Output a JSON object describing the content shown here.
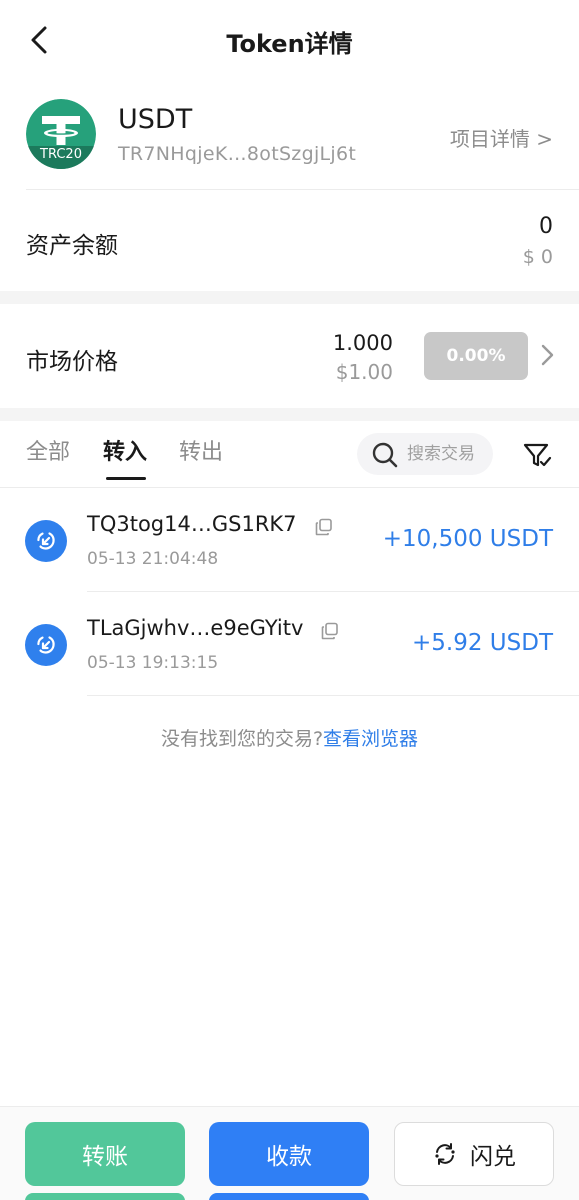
{
  "header": {
    "title": "Token详情"
  },
  "token": {
    "symbol": "USDT",
    "address": "TR7NHqjeK…8otSzgjLj6t",
    "project_detail": "项目详情 >",
    "logo_label": "TRC20",
    "logo_color": "#26a17b"
  },
  "balance": {
    "label": "资产余额",
    "amount": "0",
    "usd": "$ 0"
  },
  "market": {
    "label": "市场价格",
    "price": "1.000",
    "usd": "$1.00",
    "change": "0.00%"
  },
  "tabs": [
    {
      "label": "全部",
      "active": false
    },
    {
      "label": "转入",
      "active": true
    },
    {
      "label": "转出",
      "active": false
    }
  ],
  "search": {
    "placeholder": "搜索交易"
  },
  "transactions": [
    {
      "address": "TQ3tog14…GS1RK7",
      "time": "05-13 21:04:48",
      "amount": "+10,500 USDT"
    },
    {
      "address": "TLaGjwhv…e9eGYitv",
      "time": "05-13 19:13:15",
      "amount": "+5.92 USDT"
    }
  ],
  "not_found": {
    "text": "没有找到您的交易?",
    "link": "查看浏览器"
  },
  "actions": {
    "transfer": "转账",
    "receive": "收款",
    "swap": "闪兑"
  },
  "colors": {
    "accent_blue": "#2f7ee8",
    "transfer_green": "#52c79a",
    "receive_blue": "#2f7ff5",
    "tether_green": "#26a17b"
  }
}
